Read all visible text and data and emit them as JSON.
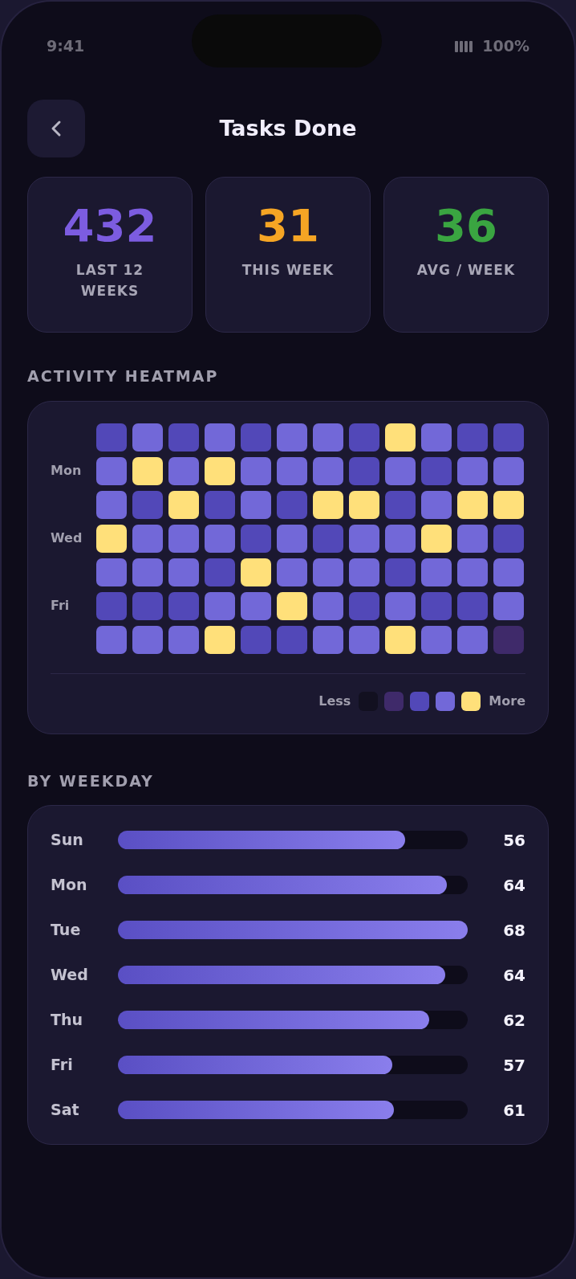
{
  "status_bar": {
    "time": "9:41",
    "battery": "100%"
  },
  "header": {
    "title": "Tasks Done"
  },
  "stats": [
    {
      "value": "432",
      "label": "LAST 12 WEEKS",
      "color": "#7c5ce0"
    },
    {
      "value": "31",
      "label": "THIS WEEK",
      "color": "#f5a524"
    },
    {
      "value": "36",
      "label": "AVG / WEEK",
      "color": "#3aa541"
    }
  ],
  "heatmap": {
    "title": "ACTIVITY HEATMAP",
    "rows": [
      {
        "cells": [
          {
            "color": "#5248b8"
          },
          {
            "color": "#7268d8"
          },
          {
            "color": "#5248b8"
          },
          {
            "color": "#7268d8"
          },
          {
            "color": "#5248b8"
          },
          {
            "color": "#7268d8"
          },
          {
            "color": "#7268d8"
          },
          {
            "color": "#5248b8"
          },
          {
            "color": "#ffe07a"
          },
          {
            "color": "#7268d8"
          },
          {
            "color": "#5248b8"
          },
          {
            "color": "#5248b8"
          }
        ]
      },
      {
        "label": "Mon",
        "cells": [
          {
            "color": "#7268d8"
          },
          {
            "color": "#ffe07a"
          },
          {
            "color": "#7268d8"
          },
          {
            "color": "#ffe07a"
          },
          {
            "color": "#7268d8"
          },
          {
            "color": "#7268d8"
          },
          {
            "color": "#7268d8"
          },
          {
            "color": "#5248b8"
          },
          {
            "color": "#7268d8"
          },
          {
            "color": "#5248b8"
          },
          {
            "color": "#7268d8"
          },
          {
            "color": "#7268d8"
          }
        ]
      },
      {
        "cells": [
          {
            "color": "#7268d8"
          },
          {
            "color": "#5248b8"
          },
          {
            "color": "#ffe07a"
          },
          {
            "color": "#5248b8"
          },
          {
            "color": "#7268d8"
          },
          {
            "color": "#5248b8"
          },
          {
            "color": "#ffe07a"
          },
          {
            "color": "#ffe07a"
          },
          {
            "color": "#5248b8"
          },
          {
            "color": "#7268d8"
          },
          {
            "color": "#ffe07a"
          },
          {
            "color": "#ffe07a"
          }
        ]
      },
      {
        "label": "Wed",
        "cells": [
          {
            "color": "#ffe07a"
          },
          {
            "color": "#7268d8"
          },
          {
            "color": "#7268d8"
          },
          {
            "color": "#7268d8"
          },
          {
            "color": "#5248b8"
          },
          {
            "color": "#7268d8"
          },
          {
            "color": "#5248b8"
          },
          {
            "color": "#7268d8"
          },
          {
            "color": "#7268d8"
          },
          {
            "color": "#ffe07a"
          },
          {
            "color": "#7268d8"
          },
          {
            "color": "#5248b8"
          }
        ]
      },
      {
        "cells": [
          {
            "color": "#7268d8"
          },
          {
            "color": "#7268d8"
          },
          {
            "color": "#7268d8"
          },
          {
            "color": "#5248b8"
          },
          {
            "color": "#ffe07a"
          },
          {
            "color": "#7268d8"
          },
          {
            "color": "#7268d8"
          },
          {
            "color": "#7268d8"
          },
          {
            "color": "#5248b8"
          },
          {
            "color": "#7268d8"
          },
          {
            "color": "#7268d8"
          },
          {
            "color": "#7268d8"
          }
        ]
      },
      {
        "label": "Fri",
        "cells": [
          {
            "color": "#5248b8"
          },
          {
            "color": "#5248b8"
          },
          {
            "color": "#5248b8"
          },
          {
            "color": "#7268d8"
          },
          {
            "color": "#7268d8"
          },
          {
            "color": "#ffe07a"
          },
          {
            "color": "#7268d8"
          },
          {
            "color": "#5248b8"
          },
          {
            "color": "#7268d8"
          },
          {
            "color": "#5248b8"
          },
          {
            "color": "#5248b8"
          },
          {
            "color": "#7268d8"
          }
        ]
      },
      {
        "cells": [
          {
            "color": "#7268d8"
          },
          {
            "color": "#7268d8"
          },
          {
            "color": "#7268d8"
          },
          {
            "color": "#ffe07a"
          },
          {
            "color": "#5248b8"
          },
          {
            "color": "#5248b8"
          },
          {
            "color": "#7268d8"
          },
          {
            "color": "#7268d8"
          },
          {
            "color": "#ffe07a"
          },
          {
            "color": "#7268d8"
          },
          {
            "color": "#7268d8"
          },
          {
            "color": "#3f2a6a"
          }
        ]
      }
    ],
    "legend": {
      "less": "Less",
      "more": "More",
      "swatches": [
        {
          "color": "#121020"
        },
        {
          "color": "#3f2a6a"
        },
        {
          "color": "#5248b8"
        },
        {
          "color": "#7268d8"
        },
        {
          "color": "#ffe07a"
        }
      ]
    }
  },
  "weekdays": {
    "title": "BY WEEKDAY",
    "rows": [
      {
        "day": "Sun",
        "count": "56",
        "level": 0.82
      },
      {
        "day": "Mon",
        "count": "64",
        "level": 0.94
      },
      {
        "day": "Tue",
        "count": "68",
        "level": 1
      },
      {
        "day": "Wed",
        "count": "64",
        "level": 0.935
      },
      {
        "day": "Thu",
        "count": "62",
        "level": 0.89
      },
      {
        "day": "Fri",
        "count": "57",
        "level": 0.785
      },
      {
        "day": "Sat",
        "count": "61",
        "level": 0.79
      }
    ]
  }
}
